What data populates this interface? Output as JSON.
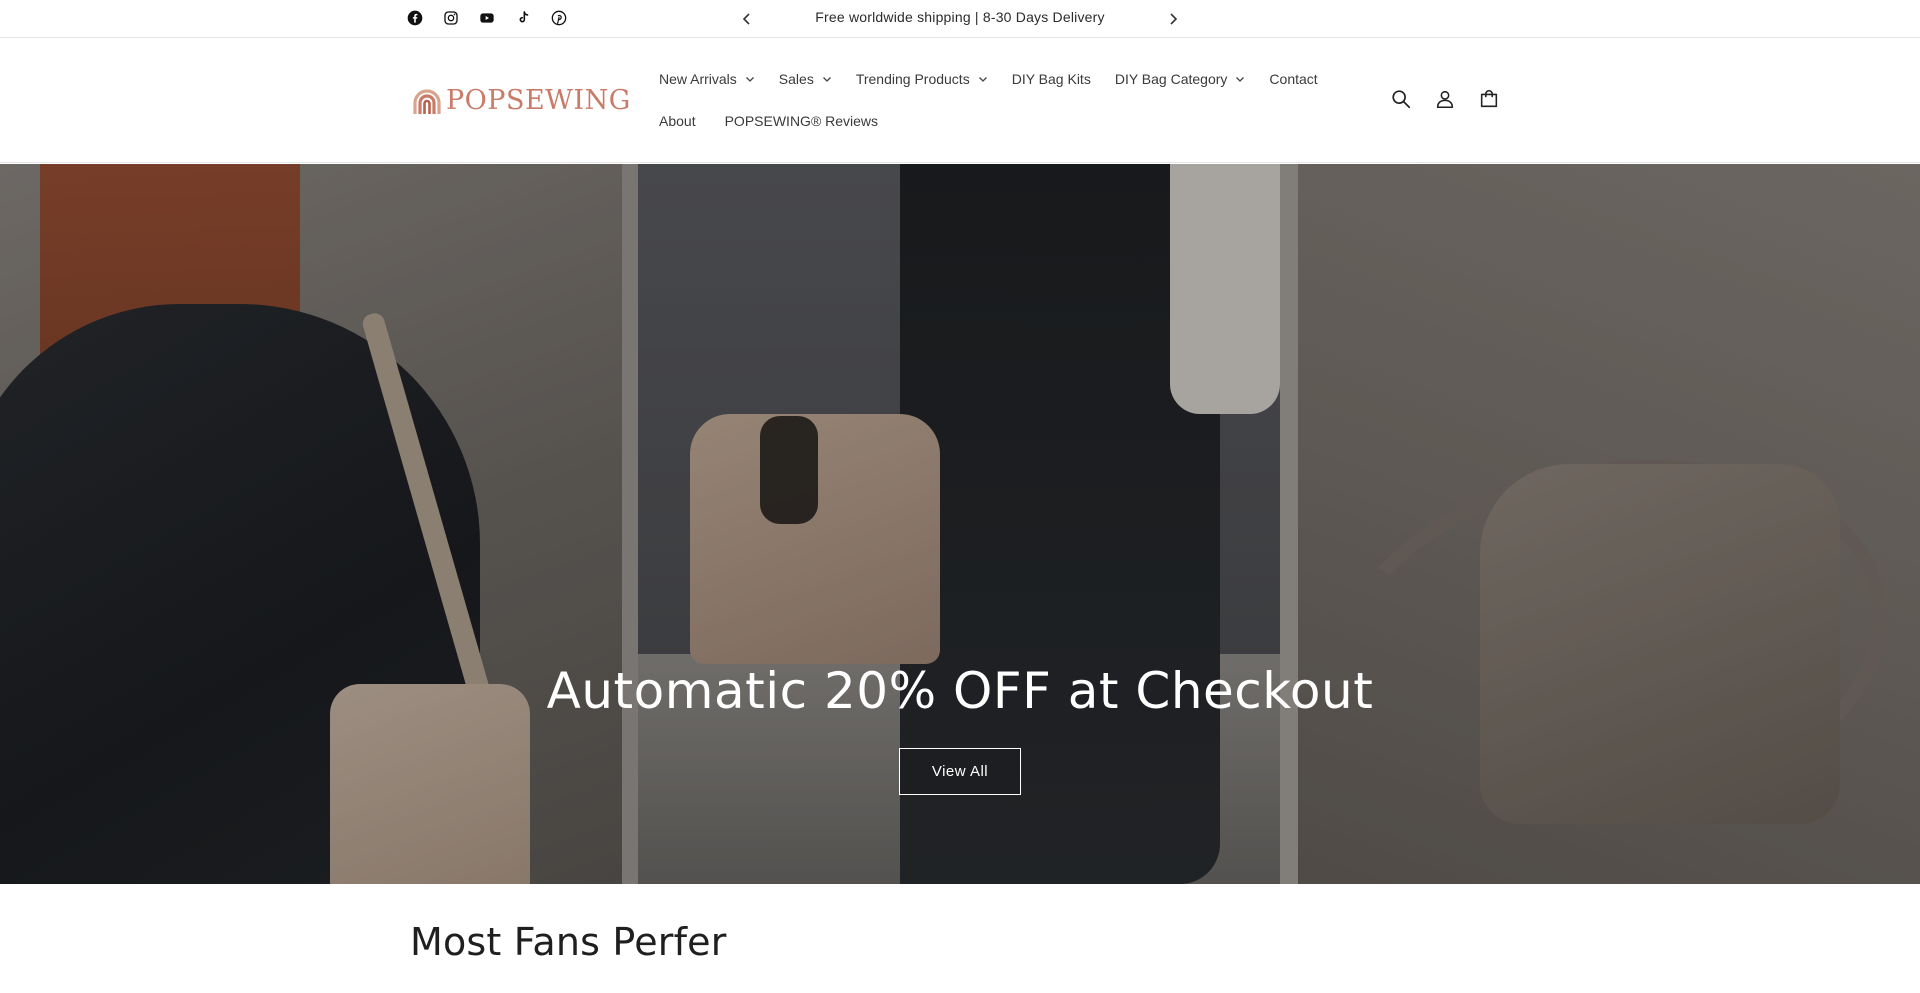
{
  "announcement": {
    "text": "Free worldwide shipping | 8-30 Days Delivery",
    "socials": [
      "facebook-icon",
      "instagram-icon",
      "youtube-icon",
      "tiktok-icon",
      "pinterest-icon"
    ]
  },
  "header": {
    "logo_text": "POPSEWING",
    "nav_row1": [
      {
        "label": "New Arrivals",
        "dropdown": true
      },
      {
        "label": "Sales",
        "dropdown": true
      },
      {
        "label": "Trending Products",
        "dropdown": true
      },
      {
        "label": "DIY Bag Kits",
        "dropdown": false
      },
      {
        "label": "DIY Bag Category",
        "dropdown": true
      },
      {
        "label": "Contact",
        "dropdown": false
      }
    ],
    "nav_row2": [
      {
        "label": "About",
        "dropdown": false
      },
      {
        "label": "POPSEWING® Reviews",
        "dropdown": false
      }
    ],
    "icons": [
      "search-icon",
      "account-icon",
      "cart-icon"
    ]
  },
  "hero": {
    "title": "Automatic 20% OFF at Checkout",
    "button_label": "View All"
  },
  "section": {
    "title": "Most Fans Perfer"
  },
  "colors": {
    "brand": "#c97b68",
    "text": "#222222",
    "border": "#e6e6e6"
  }
}
